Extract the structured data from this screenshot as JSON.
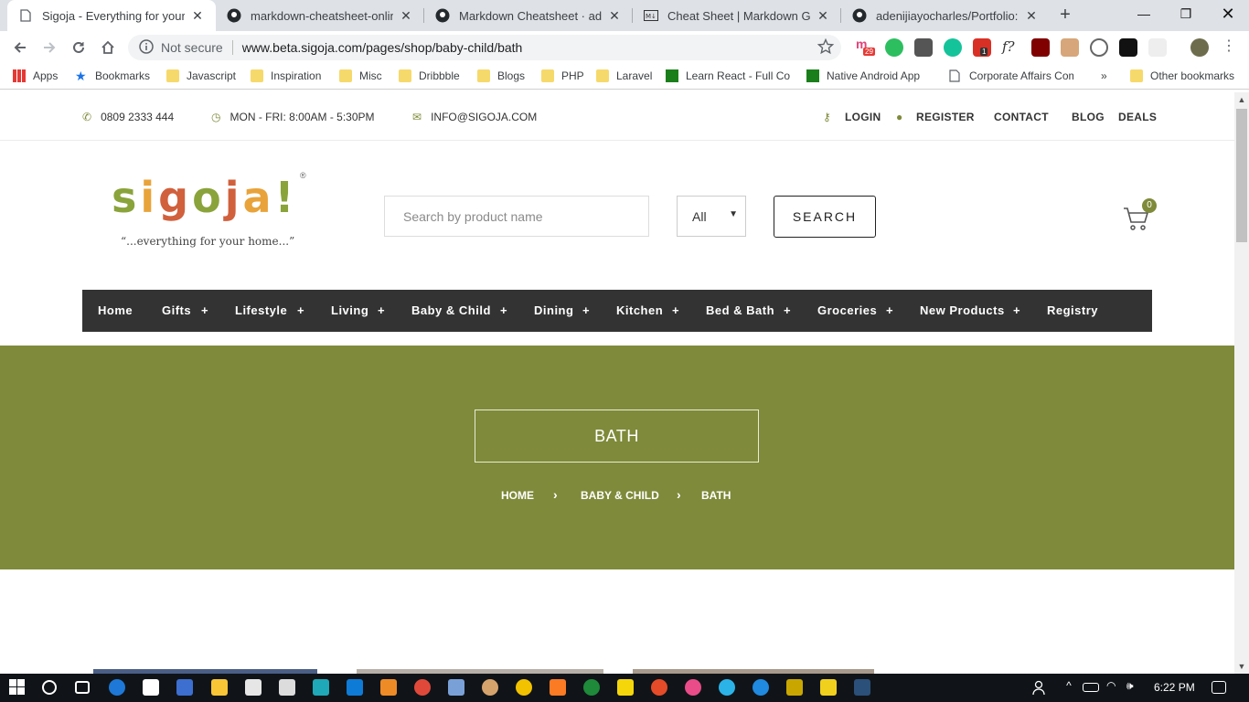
{
  "browser": {
    "tabs": [
      {
        "title": "Sigoja - Everything for your home"
      },
      {
        "title": "markdown-cheatsheet-online"
      },
      {
        "title": "Markdown Cheatsheet · adam-p"
      },
      {
        "title": "Cheat Sheet | Markdown Guide"
      },
      {
        "title": "adenijiayocharles/Portfolio: List"
      }
    ],
    "security_label": "Not secure",
    "url": "www.beta.sigoja.com/pages/shop/baby-child/bath",
    "bookmarks": [
      "Apps",
      "Bookmarks",
      "Javascript",
      "Inspiration",
      "Misc",
      "Dribbble",
      "Blogs",
      "PHP",
      "Laravel",
      "Learn React - Full Course",
      "Native Android App",
      "Corporate Affairs Commission"
    ],
    "other_bookmarks": "Other bookmarks",
    "overflow": "»",
    "ext_badges": {
      "notification": "29",
      "counter": "1"
    }
  },
  "topbar": {
    "phone": "0809 2333 444",
    "hours": "MON - FRI: 8:00AM - 5:30PM",
    "email": "INFO@SIGOJA.COM",
    "links": {
      "login": "LOGIN",
      "register": "REGISTER",
      "contact": "CONTACT",
      "blog": "BLOG",
      "deals": "DEALS"
    }
  },
  "logo": {
    "letters": [
      "s",
      "i",
      "g",
      "o",
      "j",
      "a",
      "!"
    ],
    "letter_colors": [
      "#8aa33b",
      "#e8a33a",
      "#d1603d",
      "#8aa33b",
      "#d1603d",
      "#e8a33a",
      "#8aa33b"
    ],
    "tagline": "“...everything for your home...”",
    "trademark": "®"
  },
  "search": {
    "placeholder": "Search by product name",
    "category": "All",
    "button": "SEARCH"
  },
  "cart": {
    "count": "0"
  },
  "nav": {
    "items": [
      "Home",
      "Gifts",
      "Lifestyle",
      "Living",
      "Baby & Child",
      "Dining",
      "Kitchen",
      "Bed & Bath",
      "Groceries",
      "New Products",
      "Registry"
    ],
    "plus": "+"
  },
  "hero": {
    "title": "BATH",
    "breadcrumb": [
      "HOME",
      "BABY & CHILD",
      "BATH"
    ],
    "separator": "›"
  },
  "taskbar": {
    "time": "6:22 PM"
  },
  "colors": {
    "accent": "#7f8a3a",
    "nav_bg": "#333333"
  }
}
